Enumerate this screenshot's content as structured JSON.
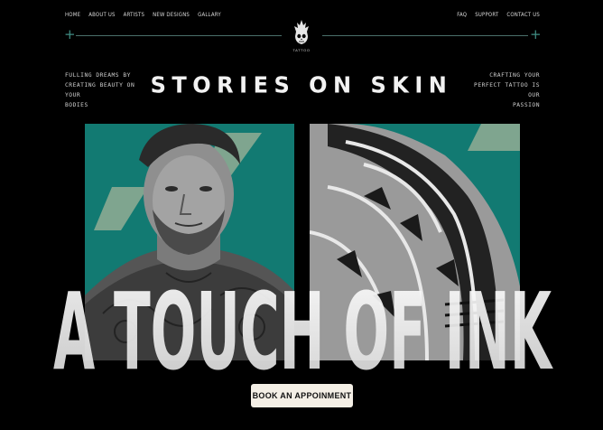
{
  "nav": {
    "left": [
      "HOME",
      "ABOUT US",
      "ARTISTS",
      "NEW DESIGNS",
      "GALLARY"
    ],
    "right": [
      "FAQ",
      "SUPPORT",
      "CONTACT US"
    ]
  },
  "logo": {
    "word": "TATTOO"
  },
  "tagline_left": [
    "FULLING DREAMS BY",
    "CREATING BEAUTY ON YOUR",
    "BODIES"
  ],
  "tagline_right": [
    "CRAFTING YOUR",
    "PERFECT TATTOO IS OUR",
    "PASSION"
  ],
  "headline": "STORIES ON SKIN",
  "hero_title": "A TOUCH OF INK",
  "cta_label": "BOOK AN APPOINMENT",
  "colors": {
    "accent": "#127a72",
    "background": "#000000",
    "cta_bg": "#f4efe6"
  }
}
